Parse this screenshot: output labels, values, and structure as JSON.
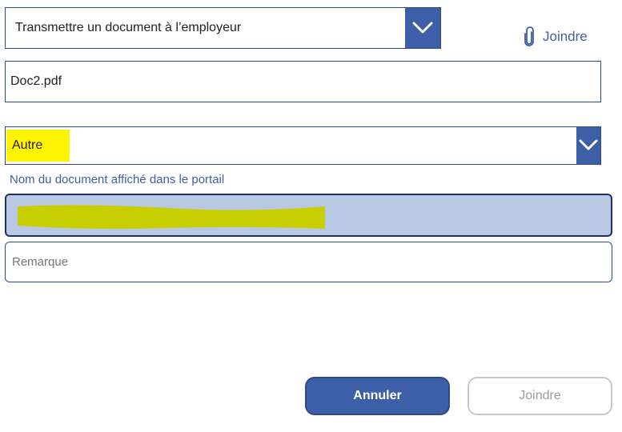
{
  "recipient_dropdown": {
    "selected": "Transmettre un document à l’employeur",
    "chevron_icon": "chevron-down-icon"
  },
  "attach": {
    "label": "Joindre",
    "icon": "paperclip-icon"
  },
  "file_field": {
    "value": "Doc2.pdf"
  },
  "category_dropdown": {
    "selected": "Autre",
    "chevron_icon": "chevron-down-icon"
  },
  "document_name": {
    "caption": "Nom du document affiché dans le portail",
    "value": ""
  },
  "remark": {
    "placeholder": "Remarque",
    "value": ""
  },
  "buttons": {
    "cancel_label": "Annuler",
    "join_label": "Joindre"
  },
  "colors": {
    "accent": "#3c5fa8",
    "border": "#2f4a8a",
    "focused_field_bg": "#b9c8e3",
    "highlight_yellow": "#fff400",
    "redaction": "#c8cf00"
  }
}
